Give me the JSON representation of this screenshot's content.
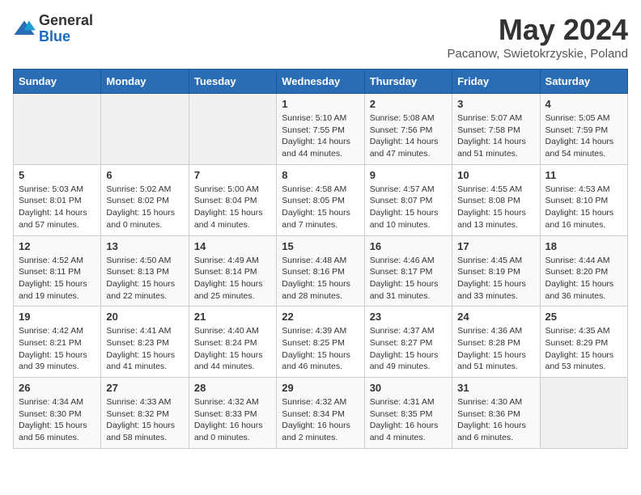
{
  "logo": {
    "general": "General",
    "blue": "Blue"
  },
  "title": {
    "month_year": "May 2024",
    "location": "Pacanow, Swietokrzyskie, Poland"
  },
  "headers": [
    "Sunday",
    "Monday",
    "Tuesday",
    "Wednesday",
    "Thursday",
    "Friday",
    "Saturday"
  ],
  "weeks": [
    [
      {
        "day": "",
        "info": ""
      },
      {
        "day": "",
        "info": ""
      },
      {
        "day": "",
        "info": ""
      },
      {
        "day": "1",
        "info": "Sunrise: 5:10 AM\nSunset: 7:55 PM\nDaylight: 14 hours\nand 44 minutes."
      },
      {
        "day": "2",
        "info": "Sunrise: 5:08 AM\nSunset: 7:56 PM\nDaylight: 14 hours\nand 47 minutes."
      },
      {
        "day": "3",
        "info": "Sunrise: 5:07 AM\nSunset: 7:58 PM\nDaylight: 14 hours\nand 51 minutes."
      },
      {
        "day": "4",
        "info": "Sunrise: 5:05 AM\nSunset: 7:59 PM\nDaylight: 14 hours\nand 54 minutes."
      }
    ],
    [
      {
        "day": "5",
        "info": "Sunrise: 5:03 AM\nSunset: 8:01 PM\nDaylight: 14 hours\nand 57 minutes."
      },
      {
        "day": "6",
        "info": "Sunrise: 5:02 AM\nSunset: 8:02 PM\nDaylight: 15 hours\nand 0 minutes."
      },
      {
        "day": "7",
        "info": "Sunrise: 5:00 AM\nSunset: 8:04 PM\nDaylight: 15 hours\nand 4 minutes."
      },
      {
        "day": "8",
        "info": "Sunrise: 4:58 AM\nSunset: 8:05 PM\nDaylight: 15 hours\nand 7 minutes."
      },
      {
        "day": "9",
        "info": "Sunrise: 4:57 AM\nSunset: 8:07 PM\nDaylight: 15 hours\nand 10 minutes."
      },
      {
        "day": "10",
        "info": "Sunrise: 4:55 AM\nSunset: 8:08 PM\nDaylight: 15 hours\nand 13 minutes."
      },
      {
        "day": "11",
        "info": "Sunrise: 4:53 AM\nSunset: 8:10 PM\nDaylight: 15 hours\nand 16 minutes."
      }
    ],
    [
      {
        "day": "12",
        "info": "Sunrise: 4:52 AM\nSunset: 8:11 PM\nDaylight: 15 hours\nand 19 minutes."
      },
      {
        "day": "13",
        "info": "Sunrise: 4:50 AM\nSunset: 8:13 PM\nDaylight: 15 hours\nand 22 minutes."
      },
      {
        "day": "14",
        "info": "Sunrise: 4:49 AM\nSunset: 8:14 PM\nDaylight: 15 hours\nand 25 minutes."
      },
      {
        "day": "15",
        "info": "Sunrise: 4:48 AM\nSunset: 8:16 PM\nDaylight: 15 hours\nand 28 minutes."
      },
      {
        "day": "16",
        "info": "Sunrise: 4:46 AM\nSunset: 8:17 PM\nDaylight: 15 hours\nand 31 minutes."
      },
      {
        "day": "17",
        "info": "Sunrise: 4:45 AM\nSunset: 8:19 PM\nDaylight: 15 hours\nand 33 minutes."
      },
      {
        "day": "18",
        "info": "Sunrise: 4:44 AM\nSunset: 8:20 PM\nDaylight: 15 hours\nand 36 minutes."
      }
    ],
    [
      {
        "day": "19",
        "info": "Sunrise: 4:42 AM\nSunset: 8:21 PM\nDaylight: 15 hours\nand 39 minutes."
      },
      {
        "day": "20",
        "info": "Sunrise: 4:41 AM\nSunset: 8:23 PM\nDaylight: 15 hours\nand 41 minutes."
      },
      {
        "day": "21",
        "info": "Sunrise: 4:40 AM\nSunset: 8:24 PM\nDaylight: 15 hours\nand 44 minutes."
      },
      {
        "day": "22",
        "info": "Sunrise: 4:39 AM\nSunset: 8:25 PM\nDaylight: 15 hours\nand 46 minutes."
      },
      {
        "day": "23",
        "info": "Sunrise: 4:37 AM\nSunset: 8:27 PM\nDaylight: 15 hours\nand 49 minutes."
      },
      {
        "day": "24",
        "info": "Sunrise: 4:36 AM\nSunset: 8:28 PM\nDaylight: 15 hours\nand 51 minutes."
      },
      {
        "day": "25",
        "info": "Sunrise: 4:35 AM\nSunset: 8:29 PM\nDaylight: 15 hours\nand 53 minutes."
      }
    ],
    [
      {
        "day": "26",
        "info": "Sunrise: 4:34 AM\nSunset: 8:30 PM\nDaylight: 15 hours\nand 56 minutes."
      },
      {
        "day": "27",
        "info": "Sunrise: 4:33 AM\nSunset: 8:32 PM\nDaylight: 15 hours\nand 58 minutes."
      },
      {
        "day": "28",
        "info": "Sunrise: 4:32 AM\nSunset: 8:33 PM\nDaylight: 16 hours\nand 0 minutes."
      },
      {
        "day": "29",
        "info": "Sunrise: 4:32 AM\nSunset: 8:34 PM\nDaylight: 16 hours\nand 2 minutes."
      },
      {
        "day": "30",
        "info": "Sunrise: 4:31 AM\nSunset: 8:35 PM\nDaylight: 16 hours\nand 4 minutes."
      },
      {
        "day": "31",
        "info": "Sunrise: 4:30 AM\nSunset: 8:36 PM\nDaylight: 16 hours\nand 6 minutes."
      },
      {
        "day": "",
        "info": ""
      }
    ]
  ]
}
